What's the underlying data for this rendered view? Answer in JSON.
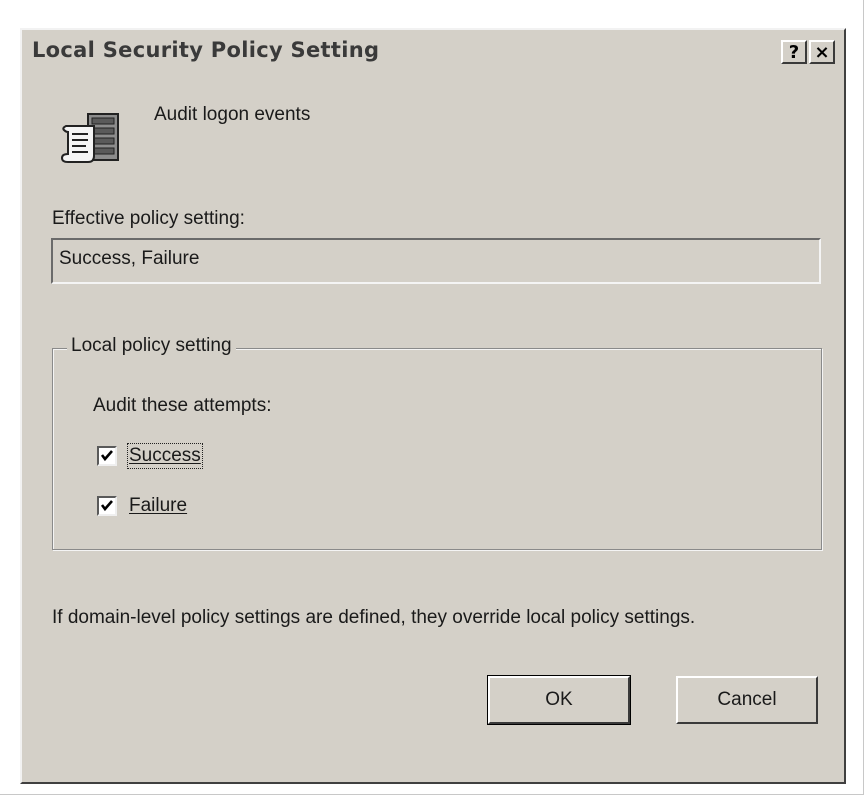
{
  "window": {
    "title": "Local Security Policy Setting",
    "help_button": "?",
    "close_button": "×"
  },
  "policy": {
    "icon": "audit-policy-icon",
    "name": "Audit logon events"
  },
  "effective": {
    "label": "Effective policy setting:",
    "value": "Success, Failure"
  },
  "local": {
    "group_label": "Local policy setting",
    "audit_label": "Audit these attempts:",
    "options": [
      {
        "label": "Success",
        "checked": true,
        "focused": true
      },
      {
        "label": "Failure",
        "checked": true,
        "focused": false
      }
    ]
  },
  "note": "If domain-level policy settings are defined, they override local policy settings.",
  "buttons": {
    "ok": "OK",
    "cancel": "Cancel"
  }
}
